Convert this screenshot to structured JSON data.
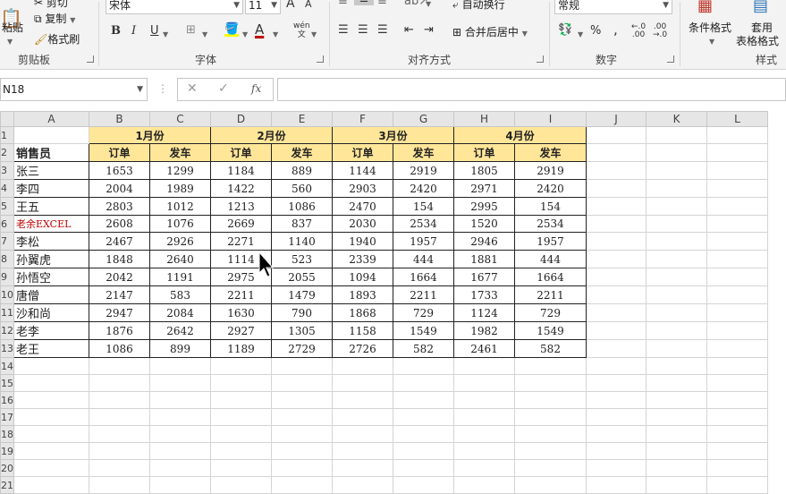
{
  "ribbon": {
    "clipboard": {
      "paste": "粘贴",
      "cut": "剪切",
      "copy": "复制",
      "format_painter": "格式刷",
      "group": "剪贴板"
    },
    "font": {
      "name": "宋体",
      "size": "11",
      "grow": "A",
      "shrink": "A",
      "bold": "B",
      "italic": "I",
      "underline": "U",
      "font_color_glyph": "A",
      "pinyin": "wén",
      "group": "字体"
    },
    "alignment": {
      "wrap": "自动换行",
      "merge": "合并后居中",
      "group": "对齐方式"
    },
    "number": {
      "format": "常规",
      "percent": "%",
      "comma": ",",
      "inc_decimal": "←.0\n.00",
      "dec_decimal": ".00\n→.0",
      "group": "数字"
    },
    "styles": {
      "conditional": "条件格式",
      "table_format_1": "套用",
      "table_format_2": "表格格式",
      "group": "样式"
    }
  },
  "formula_bar": {
    "name_box": "N18",
    "fx": "fx",
    "formula": ""
  },
  "columns": [
    "A",
    "B",
    "C",
    "D",
    "E",
    "F",
    "G",
    "H",
    "I",
    "J",
    "K",
    "L"
  ],
  "row_numbers": [
    "1",
    "2",
    "3",
    "4",
    "5",
    "6",
    "7",
    "8",
    "9",
    "10",
    "11",
    "12",
    "13",
    "14",
    "15",
    "16",
    "17",
    "18",
    "19",
    "20",
    "21"
  ],
  "months": [
    "1月份",
    "2月份",
    "3月份",
    "4月份"
  ],
  "subheaders": {
    "salesperson": "销售员",
    "order": "订单",
    "ship": "发车"
  },
  "rows": [
    {
      "name": "张三",
      "v": [
        "1653",
        "1299",
        "1184",
        "889",
        "1144",
        "2919",
        "1805",
        "2919"
      ]
    },
    {
      "name": "李四",
      "v": [
        "2004",
        "1989",
        "1422",
        "560",
        "2903",
        "2420",
        "2971",
        "2420"
      ]
    },
    {
      "name": "王五",
      "v": [
        "2803",
        "1012",
        "1213",
        "1086",
        "2470",
        "154",
        "2995",
        "154"
      ]
    },
    {
      "name": "老余EXCEL",
      "v": [
        "2608",
        "1076",
        "2669",
        "837",
        "2030",
        "2534",
        "1520",
        "2534"
      ],
      "highlight": "#c00000"
    },
    {
      "name": "李松",
      "v": [
        "2467",
        "2926",
        "2271",
        "1140",
        "1940",
        "1957",
        "2946",
        "1957"
      ]
    },
    {
      "name": "孙翼虎",
      "v": [
        "1848",
        "2640",
        "1114",
        "523",
        "2339",
        "444",
        "1881",
        "444"
      ]
    },
    {
      "name": "孙悟空",
      "v": [
        "2042",
        "1191",
        "2975",
        "2055",
        "1094",
        "1664",
        "1677",
        "1664"
      ]
    },
    {
      "name": "唐僧",
      "v": [
        "2147",
        "583",
        "2211",
        "1479",
        "1893",
        "2211",
        "1733",
        "2211"
      ]
    },
    {
      "name": "沙和尚",
      "v": [
        "2947",
        "2084",
        "1630",
        "790",
        "1868",
        "729",
        "1124",
        "729"
      ]
    },
    {
      "name": "老李",
      "v": [
        "1876",
        "2642",
        "2927",
        "1305",
        "1158",
        "1549",
        "1982",
        "1549"
      ]
    },
    {
      "name": "老王",
      "v": [
        "1086",
        "899",
        "1189",
        "2729",
        "2726",
        "582",
        "2461",
        "582"
      ]
    }
  ],
  "colors": {
    "header_fill": "#ffe699",
    "highlight_text": "#c00000",
    "ribbon_bg": "#f3f3f3",
    "grid_line": "#d4d4d4"
  }
}
